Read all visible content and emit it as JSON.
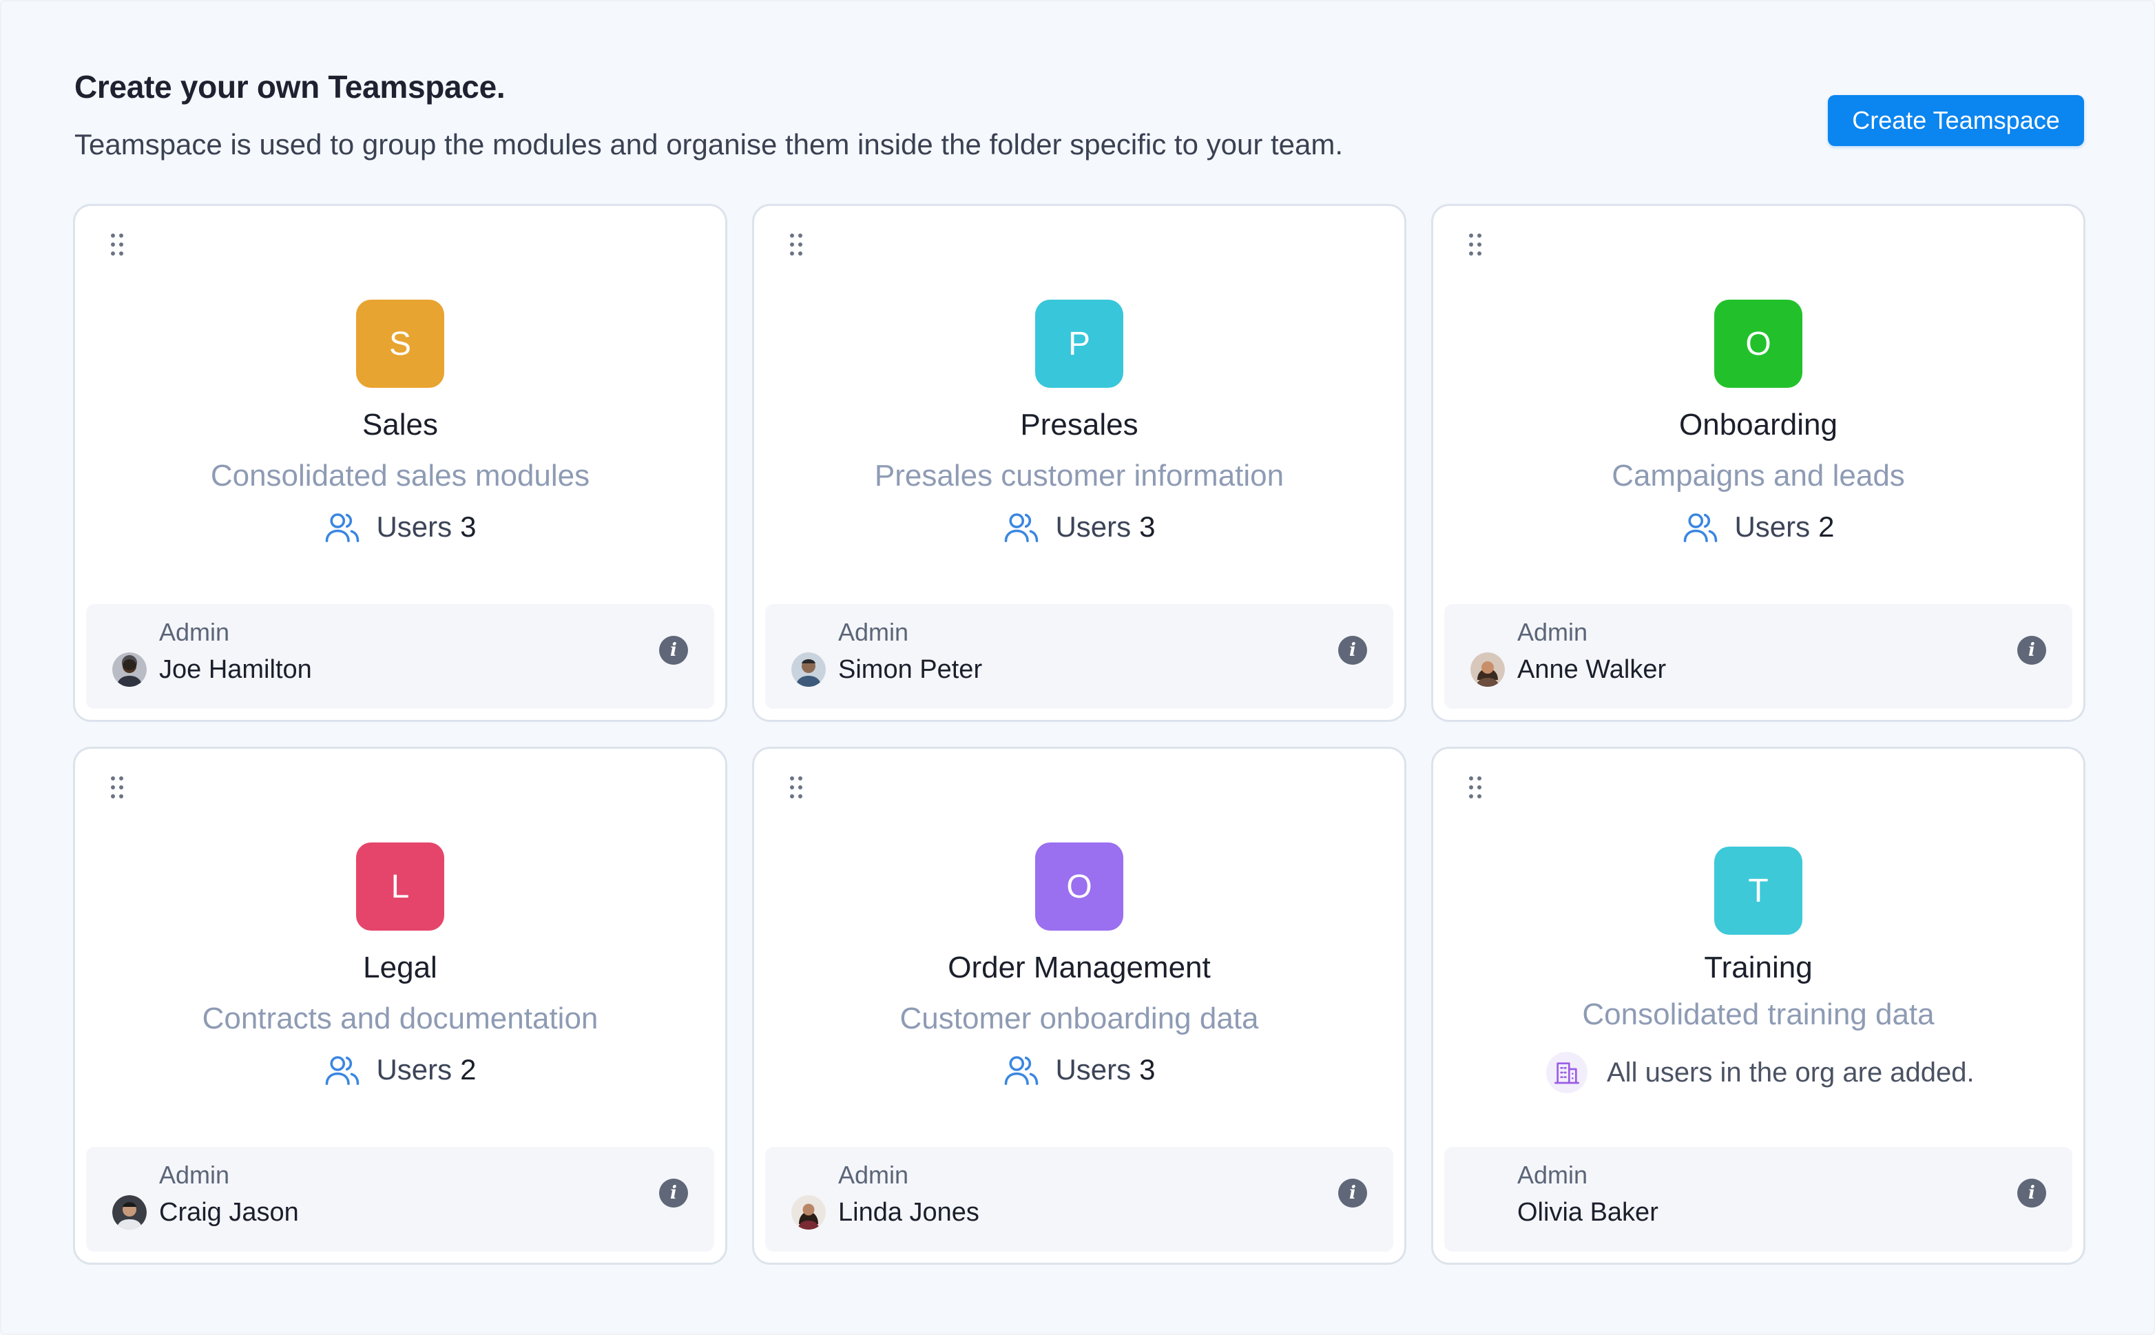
{
  "header": {
    "title": "Create your own Teamspace.",
    "subtitle": "Teamspace is used to group the modules and organise them inside the folder specific to your team.",
    "create_button": "Create Teamspace"
  },
  "teamspaces": [
    {
      "letter": "S",
      "color": "#e8a431",
      "name": "Sales",
      "description": "Consolidated sales modules",
      "users_label": "Users",
      "users_count": "3",
      "admin_label": "Admin",
      "admin_name": "Joe Hamilton"
    },
    {
      "letter": "P",
      "color": "#38c6da",
      "name": "Presales",
      "description": "Presales customer information",
      "users_label": "Users",
      "users_count": "3",
      "admin_label": "Admin",
      "admin_name": "Simon Peter"
    },
    {
      "letter": "O",
      "color": "#22c12c",
      "name": "Onboarding",
      "description": "Campaigns and leads",
      "users_label": "Users",
      "users_count": "2",
      "admin_label": "Admin",
      "admin_name": "Anne Walker"
    },
    {
      "letter": "L",
      "color": "#e5456a",
      "name": "Legal",
      "description": "Contracts and documentation",
      "users_label": "Users",
      "users_count": "2",
      "admin_label": "Admin",
      "admin_name": "Craig Jason"
    },
    {
      "letter": "O",
      "color": "#9a6ff0",
      "name": "Order Management",
      "description": "Customer onboarding data",
      "users_label": "Users",
      "users_count": "3",
      "admin_label": "Admin",
      "admin_name": "Linda Jones"
    },
    {
      "letter": "T",
      "color": "#3ec9d9",
      "name": "Training",
      "description": "Consolidated training data",
      "org_text": "All users in the org are added.",
      "admin_label": "Admin",
      "admin_name": "Olivia Baker"
    }
  ],
  "icons": {
    "drag": "drag-handle-icon",
    "users": "users-icon",
    "info": "info-icon",
    "org": "building-icon",
    "avatar": "avatar"
  },
  "colors": {
    "primary": "#0b85f0",
    "description": "#8e9bb4",
    "users_icon": "#3a86e0",
    "org_icon": "#9b5de5"
  }
}
